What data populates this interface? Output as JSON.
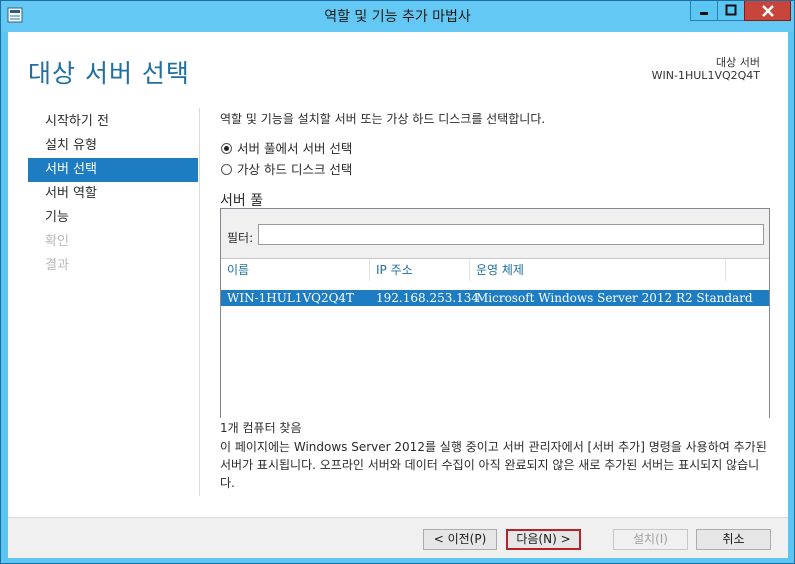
{
  "window": {
    "title": "역할 및 기능 추가 마법사"
  },
  "header": {
    "page_title": "대상 서버 선택",
    "dest_label": "대상 서버",
    "dest_name": "WIN-1HUL1VQ2Q4T"
  },
  "nav": {
    "items": [
      {
        "label": "시작하기 전",
        "state": "normal"
      },
      {
        "label": "설치 유형",
        "state": "normal"
      },
      {
        "label": "서버 선택",
        "state": "active"
      },
      {
        "label": "서버 역할",
        "state": "normal"
      },
      {
        "label": "기능",
        "state": "normal"
      },
      {
        "label": "확인",
        "state": "disabled"
      },
      {
        "label": "결과",
        "state": "disabled"
      }
    ]
  },
  "main": {
    "instruction": "역할 및 기능을 설치할 서버 또는 가상 하드 디스크를 선택합니다.",
    "radio_pool": "서버 풀에서 서버 선택",
    "radio_vhd": "가상 하드 디스크 선택",
    "pool_label": "서버 풀",
    "filter_label": "필터:",
    "filter_value": "",
    "columns": [
      "이름",
      "IP 주소",
      "운영 체제"
    ],
    "rows": [
      {
        "name": "WIN-1HUL1VQ2Q4T",
        "ip": "192.168.253.134",
        "os": "Microsoft Windows Server 2012 R2 Standard"
      }
    ],
    "found_text": "1개 컴퓨터 찾음",
    "description": "이 페이지에는 Windows Server 2012를 실행 중이고 서버 관리자에서 [서버 추가] 명령을 사용하여 추가된 서버가 표시됩니다. 오프라인 서버와 데이터 수집이 아직 완료되지 않은 새로 추가된 서버는 표시되지 않습니다."
  },
  "footer": {
    "prev": "< 이전(P)",
    "next": "다음(N) >",
    "install": "설치(I)",
    "cancel": "취소"
  },
  "colors": {
    "accent": "#1d7cc2",
    "titlebar": "#63c8f4",
    "close": "#c7453a"
  }
}
